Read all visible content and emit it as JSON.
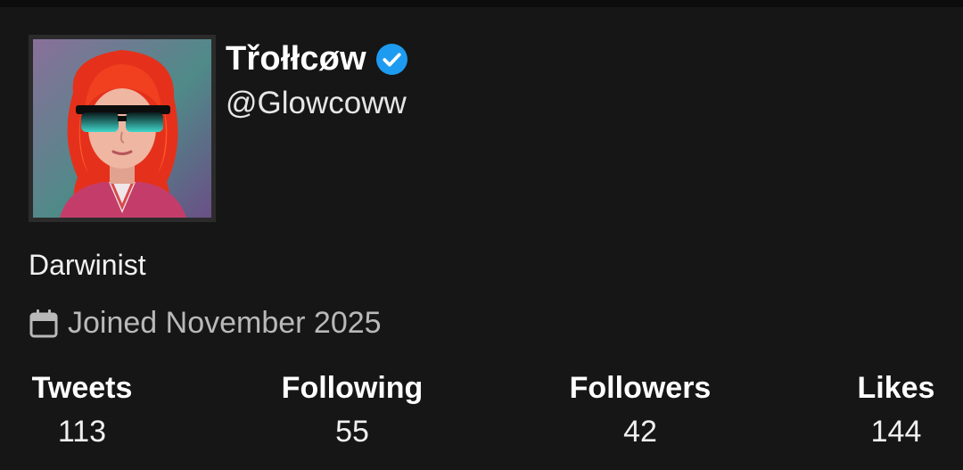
{
  "profile": {
    "display_name": "Třołłcøw",
    "verified_icon": "verified-badge-icon",
    "handle": "@Glowcoww",
    "bio": "Darwinist",
    "joined": "Joined November 2025",
    "joined_icon": "calendar-icon"
  },
  "stats": [
    {
      "label": "Tweets",
      "value": "113"
    },
    {
      "label": "Following",
      "value": "55"
    },
    {
      "label": "Followers",
      "value": "42"
    },
    {
      "label": "Likes",
      "value": "144"
    }
  ],
  "colors": {
    "background": "#161616",
    "verified_blue": "#1d9bf0",
    "muted_text": "#b9b9b9"
  }
}
